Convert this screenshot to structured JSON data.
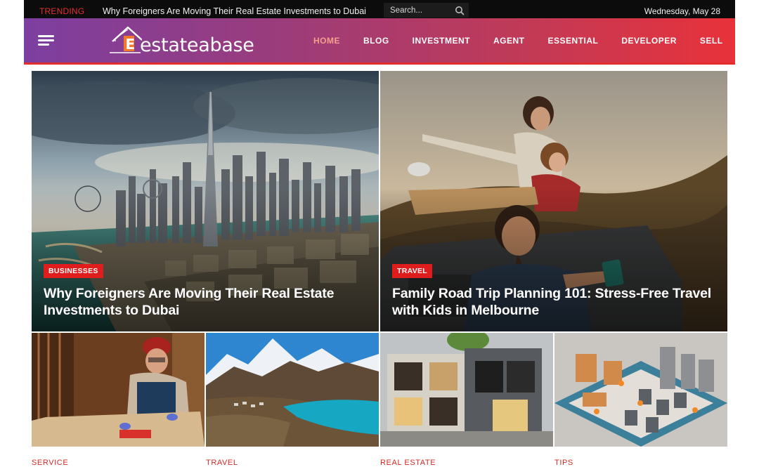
{
  "topbar": {
    "trending_label": "TRENDING",
    "trending_text": "Why Foreigners Are Moving Their Real Estate Investments to Dubai",
    "search_placeholder": "Search...",
    "date": "Wednesday, May 28"
  },
  "header": {
    "logo_text": "estateabase",
    "logo_letter": "E",
    "nav": [
      "HOME",
      "BLOG",
      "INVESTMENT",
      "AGENT",
      "ESSENTIAL",
      "DEVELOPER",
      "SELL"
    ],
    "active_nav": "HOME"
  },
  "featured": [
    {
      "category": "BUSINESSES",
      "title": "Why Foreigners Are Moving Their Real Estate Investments to Dubai"
    },
    {
      "category": "TRAVEL",
      "title": "Family Road Trip Planning 101: Stress-Free Travel with Kids in Melbourne"
    }
  ],
  "small_cards": [
    {
      "category": "SERVICE"
    },
    {
      "category": "TRAVEL"
    },
    {
      "category": "REAL ESTATE"
    },
    {
      "category": "TIPS"
    }
  ],
  "colors": {
    "accent_red": "#e01d1d",
    "header_gradient_start": "#7c3fa0",
    "header_gradient_end": "#e8323a",
    "active_nav": "#f3a18c"
  }
}
